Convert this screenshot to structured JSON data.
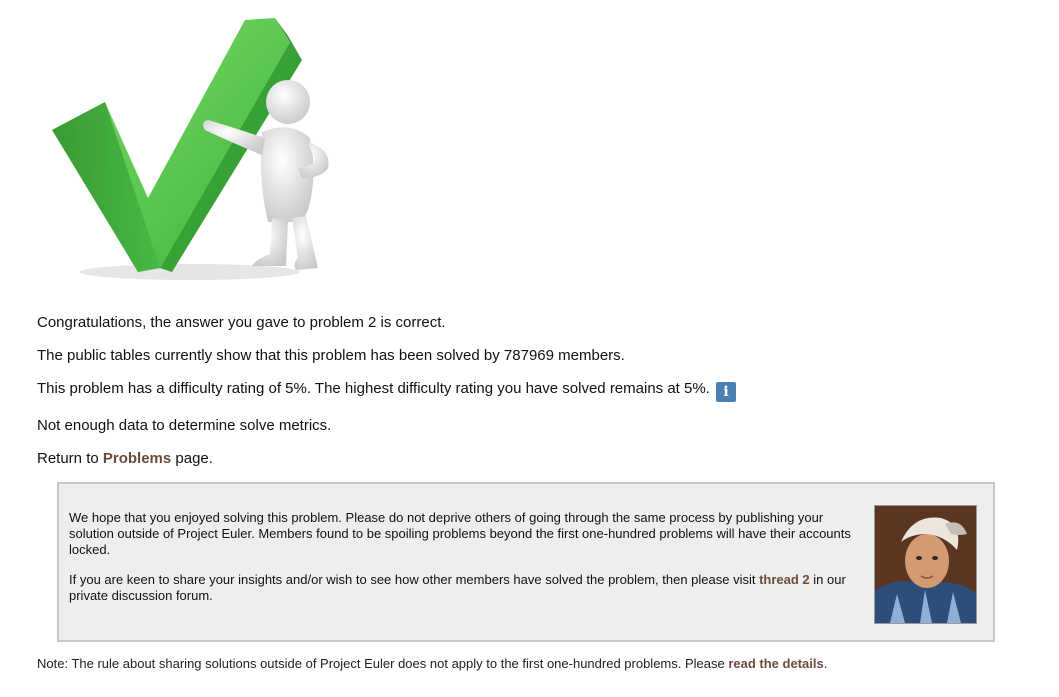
{
  "result": {
    "congrats": "Congratulations, the answer you gave to problem 2 is correct.",
    "solved_prefix": "The public tables currently show that this problem has been solved by 787969 members.",
    "difficulty": "This problem has a difficulty rating of 5%. The highest difficulty rating you have solved remains at 5%.",
    "info_glyph": "i",
    "metrics": "Not enough data to determine solve metrics.",
    "return_prefix": "Return to ",
    "return_link": "Problems",
    "return_suffix": " page."
  },
  "notice": {
    "para1": "We hope that you enjoyed solving this problem. Please do not deprive others of going through the same process by publishing your solution outside of Project Euler. Members found to be spoiling problems beyond the first one-hundred problems will have their accounts locked.",
    "para2_prefix": "If you are keen to share your insights and/or wish to see how other members have solved the problem, then please visit ",
    "para2_link": "thread 2",
    "para2_suffix": " in our private discussion forum."
  },
  "footnote": {
    "prefix": "Note: The rule about sharing solutions outside of Project Euler does not apply to the first one-hundred problems. Please ",
    "link": "read the details",
    "suffix": "."
  },
  "colors": {
    "link": "#6b4c3b",
    "check_green": "#4cc34a",
    "info_blue": "#4a7fb0",
    "notice_bg": "#eeeeee"
  },
  "icons": {
    "hero": "checkmark-figure-icon",
    "info": "info-icon",
    "portrait": "euler-portrait"
  }
}
